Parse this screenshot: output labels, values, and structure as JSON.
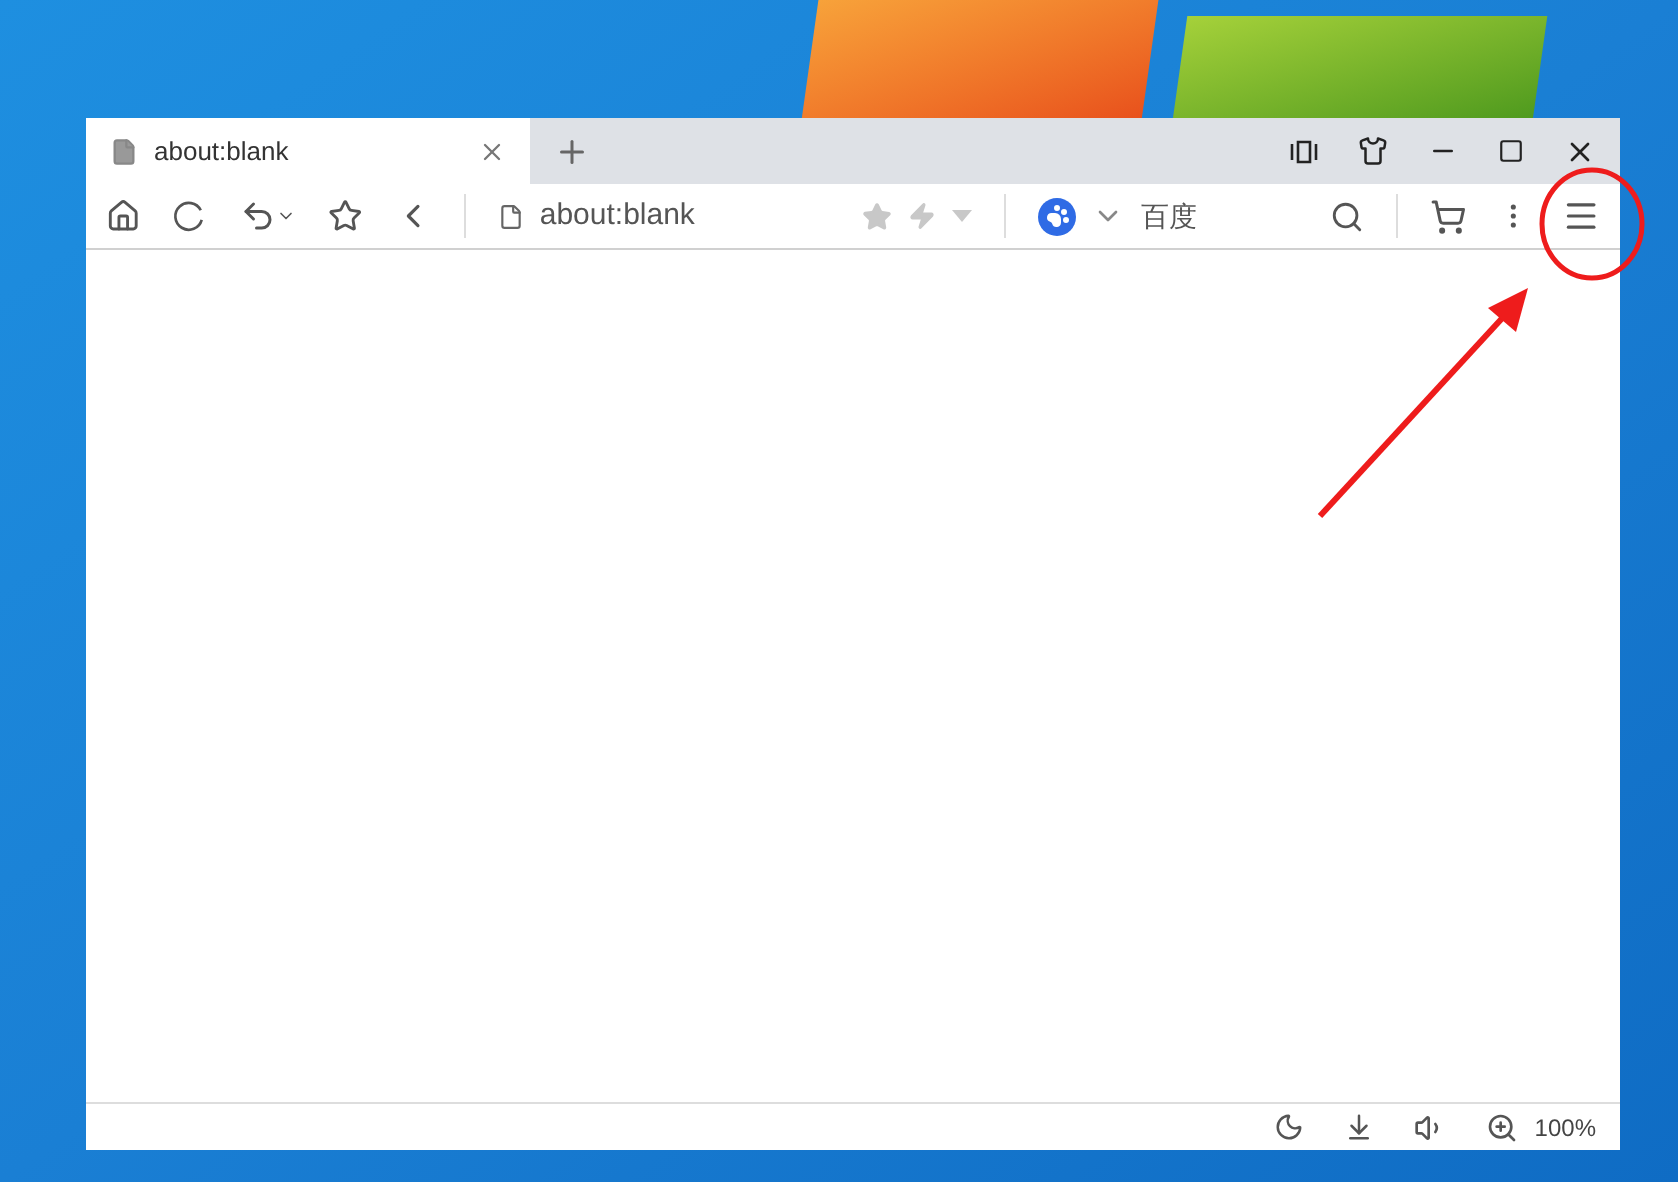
{
  "tabs": [
    {
      "title": "about:blank",
      "selected": true
    }
  ],
  "address_bar": {
    "value": "about:blank"
  },
  "search": {
    "engine": "百度"
  },
  "status_bar": {
    "zoom": "100%"
  }
}
